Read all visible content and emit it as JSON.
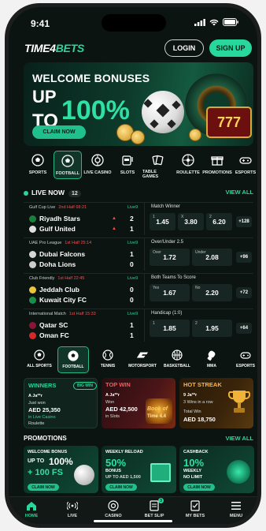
{
  "status": {
    "time": "9:41"
  },
  "header": {
    "logo_a": "TIME4",
    "logo_b": "BETS",
    "login": "LOGIN",
    "signup": "SIGN UP"
  },
  "hero": {
    "line1": "WELCOME BONUSES",
    "line2": "UP",
    "line3": "TO",
    "pct": "100%",
    "claim": "CLAIM NOW",
    "slot": "777"
  },
  "categories": [
    {
      "label": "SPORTS",
      "icon": "soccer-ball-icon"
    },
    {
      "label": "FOOTBALL",
      "icon": "football-icon",
      "active": true
    },
    {
      "label": "LIVE CASINO",
      "icon": "live-casino-icon"
    },
    {
      "label": "SLOTS",
      "icon": "slot-machine-icon"
    },
    {
      "label": "TABLE GAMES",
      "icon": "cards-icon"
    },
    {
      "label": "ROULETTE",
      "icon": "roulette-icon"
    },
    {
      "label": "PROMOTIONS",
      "icon": "gift-icon"
    },
    {
      "label": "ESPORTS",
      "icon": "gamepad-icon"
    }
  ],
  "live": {
    "title": "LIVE NOW",
    "count": "12",
    "view_all": "VIEW ALL",
    "matches": [
      {
        "league": "Gulf Cup Live",
        "period": "2nd Half 68:21",
        "live": "Live9",
        "home": "Riyadh Stars",
        "away": "Gulf United",
        "home_score": "2",
        "away_score": "1",
        "market": "Match Winner",
        "odds": [
          {
            "label": "1",
            "value": "1.45"
          },
          {
            "label": "X",
            "value": "3.80"
          },
          {
            "label": "2",
            "value": "6.20"
          }
        ],
        "more": "+128"
      },
      {
        "league": "UAE Pro League",
        "period": "1st Half 25:14",
        "live": "Live9",
        "home": "Dubai Falcons",
        "away": "Doha Lions",
        "home_score": "1",
        "away_score": "0",
        "market": "Over/Under 2.5",
        "odds": [
          {
            "label": "Over",
            "value": "1.72"
          },
          {
            "label": "Under",
            "value": "2.08"
          }
        ],
        "more": "+96"
      },
      {
        "league": "Club Friendly",
        "period": "1st Half 22:45",
        "live": "Live9",
        "home": "Jeddah Club",
        "away": "Kuwait City FC",
        "home_score": "0",
        "away_score": "0",
        "market": "Both Teams To Score",
        "odds": [
          {
            "label": "Yes",
            "value": "1.67"
          },
          {
            "label": "No",
            "value": "2.20"
          }
        ],
        "more": "+72"
      },
      {
        "league": "International Match",
        "period": "1st Half 15:33",
        "live": "Live9",
        "home": "Qatar SC",
        "away": "Oman FC",
        "home_score": "1",
        "away_score": "1",
        "market": "Handicap (1:0)",
        "odds": [
          {
            "label": "1",
            "value": "1.85"
          },
          {
            "label": "2",
            "value": "1.95"
          }
        ],
        "more": "+64"
      }
    ]
  },
  "sports": [
    {
      "label": "ALL SPORTS",
      "icon": "grid-icon"
    },
    {
      "label": "FOOTBALL",
      "icon": "football-icon",
      "active": true
    },
    {
      "label": "TENNIS",
      "icon": "tennis-ball-icon"
    },
    {
      "label": "MOTORSPORT",
      "icon": "f1-icon"
    },
    {
      "label": "BASKETBALL",
      "icon": "basketball-icon"
    },
    {
      "label": "MMA",
      "icon": "glove-icon"
    },
    {
      "label": "ESPORTS",
      "icon": "gamepad-icon"
    }
  ],
  "panels": {
    "winners": {
      "title": "WINNERS",
      "badge": "BIG WIN",
      "user": "A Ja**r",
      "line1": "Just won",
      "amount": "AED 25,350",
      "line2": "in Live Casino",
      "line3": "Roulette"
    },
    "top_win": {
      "title": "TOP WIN",
      "user": "A Ja**r",
      "line1": "Won",
      "amount": "AED 42,500",
      "line2": "in Slots",
      "line3": "Book of",
      "line4": "Time 4.4"
    },
    "hot_streak": {
      "title": "HOT STREAK",
      "user": "9 Ja**r",
      "line1": "3 Wins in a row",
      "line2": "Total Win",
      "amount": "AED 18,750"
    }
  },
  "promotions": {
    "title": "PROMOTIONS",
    "view_all": "VIEW ALL",
    "cards": [
      {
        "title": "WELCOME BONUS",
        "big1": "UP TO",
        "big2": "100%",
        "big3": "+ 100 FS",
        "cta": "CLAIM NOW"
      },
      {
        "title": "WEEKLY RELOAD",
        "big1": "50%",
        "big2": "BONUS",
        "big3": "UP TO AED 1,500",
        "cta": "CLAIM NOW"
      },
      {
        "title": "CASHBACK",
        "big1": "10%",
        "big2": "WEEKLY",
        "big3": "NO LIMIT",
        "cta": "CLAIM NOW"
      }
    ]
  },
  "tabs": [
    {
      "label": "HOME",
      "icon": "home-icon",
      "active": true
    },
    {
      "label": "LIVE",
      "icon": "live-signal-icon"
    },
    {
      "label": "CASINO",
      "icon": "casino-chip-icon"
    },
    {
      "label": "BET SLIP",
      "icon": "bet-slip-icon",
      "badge": "3"
    },
    {
      "label": "MY BETS",
      "icon": "my-bets-icon"
    },
    {
      "label": "MENU",
      "icon": "menu-icon"
    }
  ],
  "colors": {
    "accent": "#27d79c",
    "background": "#0c1412",
    "live_red": "#ff4a4a",
    "top_win": "#ff5757",
    "hot_streak": "#ffb43a"
  }
}
